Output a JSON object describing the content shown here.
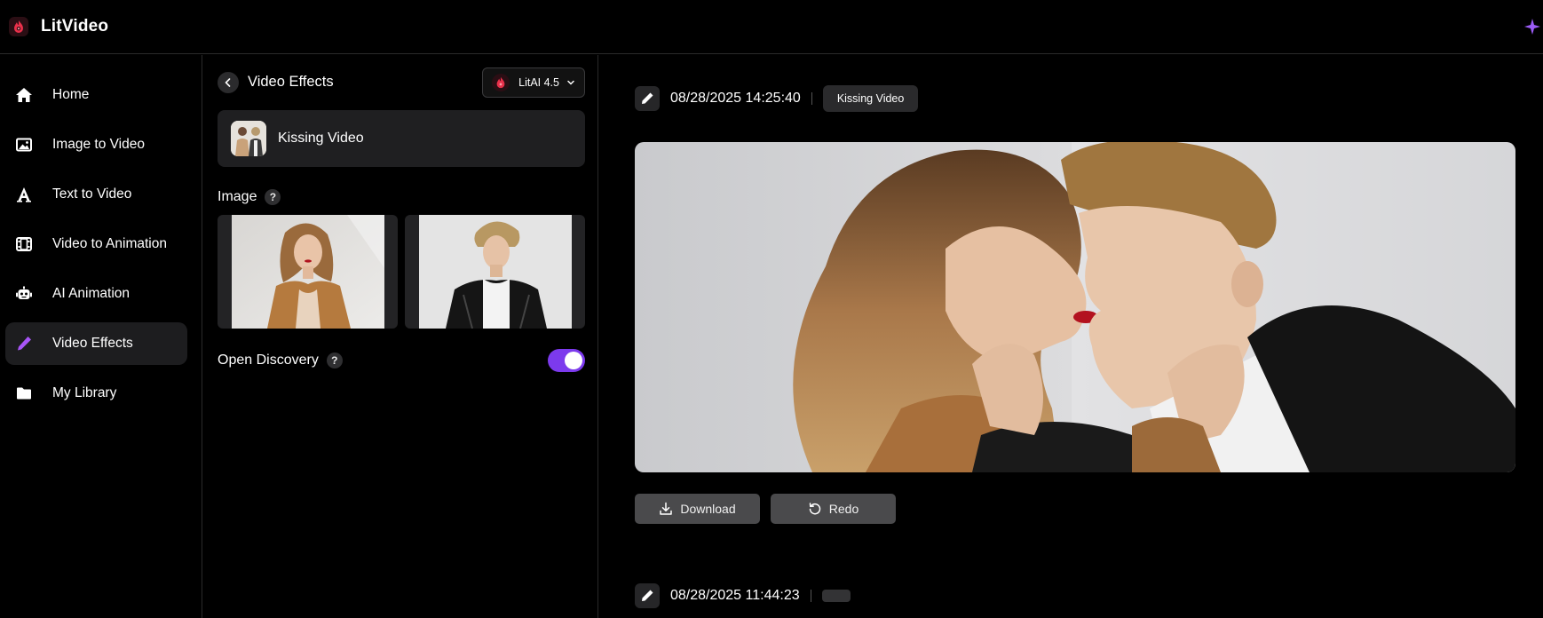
{
  "app": {
    "name": "LitVideo"
  },
  "sidebar": {
    "items": [
      {
        "label": "Home",
        "icon": "home-icon"
      },
      {
        "label": "Image to Video",
        "icon": "image-icon"
      },
      {
        "label": "Text to Video",
        "icon": "text-a-icon"
      },
      {
        "label": "Video to Animation",
        "icon": "film-icon"
      },
      {
        "label": "AI Animation",
        "icon": "robot-icon"
      },
      {
        "label": "Video Effects",
        "icon": "pen-icon",
        "active": true
      },
      {
        "label": "My Library",
        "icon": "folder-icon"
      }
    ]
  },
  "panel": {
    "title": "Video Effects",
    "model": "LitAI 4.5",
    "effect_name": "Kissing Video",
    "image_label": "Image",
    "help_mark": "?",
    "discovery_label": "Open Discovery",
    "discovery_enabled": true
  },
  "results": [
    {
      "timestamp": "08/28/2025 14:25:40",
      "tag": "Kissing Video",
      "download_label": "Download",
      "redo_label": "Redo"
    },
    {
      "timestamp": "08/28/2025 11:44:23",
      "tag": ""
    }
  ],
  "colors": {
    "accent": "#7c3aed",
    "brand": "#e8304a",
    "background": "#000000"
  }
}
